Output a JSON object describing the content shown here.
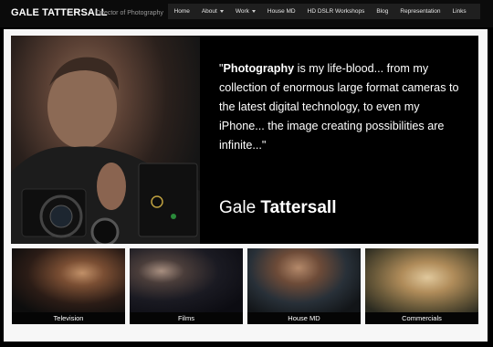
{
  "header": {
    "brand": "GALE TATTERSALL",
    "tagline": "Director of Photography"
  },
  "nav": {
    "items": [
      {
        "label": "Home",
        "dropdown": false
      },
      {
        "label": "About",
        "dropdown": true
      },
      {
        "label": "Work",
        "dropdown": true
      },
      {
        "label": "House MD",
        "dropdown": false
      },
      {
        "label": "HD DSLR Workshops",
        "dropdown": false
      },
      {
        "label": "Blog",
        "dropdown": false
      },
      {
        "label": "Representation",
        "dropdown": false
      },
      {
        "label": "Links",
        "dropdown": false
      }
    ]
  },
  "hero": {
    "quote_open": "\"",
    "quote_bold": "Photography",
    "quote_rest": " is my life-blood... from my collection of enormous large format cameras to the latest digital technology, to even my iPhone... the image creating possibilities are infinite...\"",
    "name_first": "Gale ",
    "name_last": "Tattersall"
  },
  "thumbnails": [
    {
      "label": "Television"
    },
    {
      "label": "Films"
    },
    {
      "label": "House MD"
    },
    {
      "label": "Commercials"
    }
  ],
  "colors": {
    "background": "#000000",
    "frame": "#f7f7f7",
    "nav_bar": "#1f1f1f"
  }
}
